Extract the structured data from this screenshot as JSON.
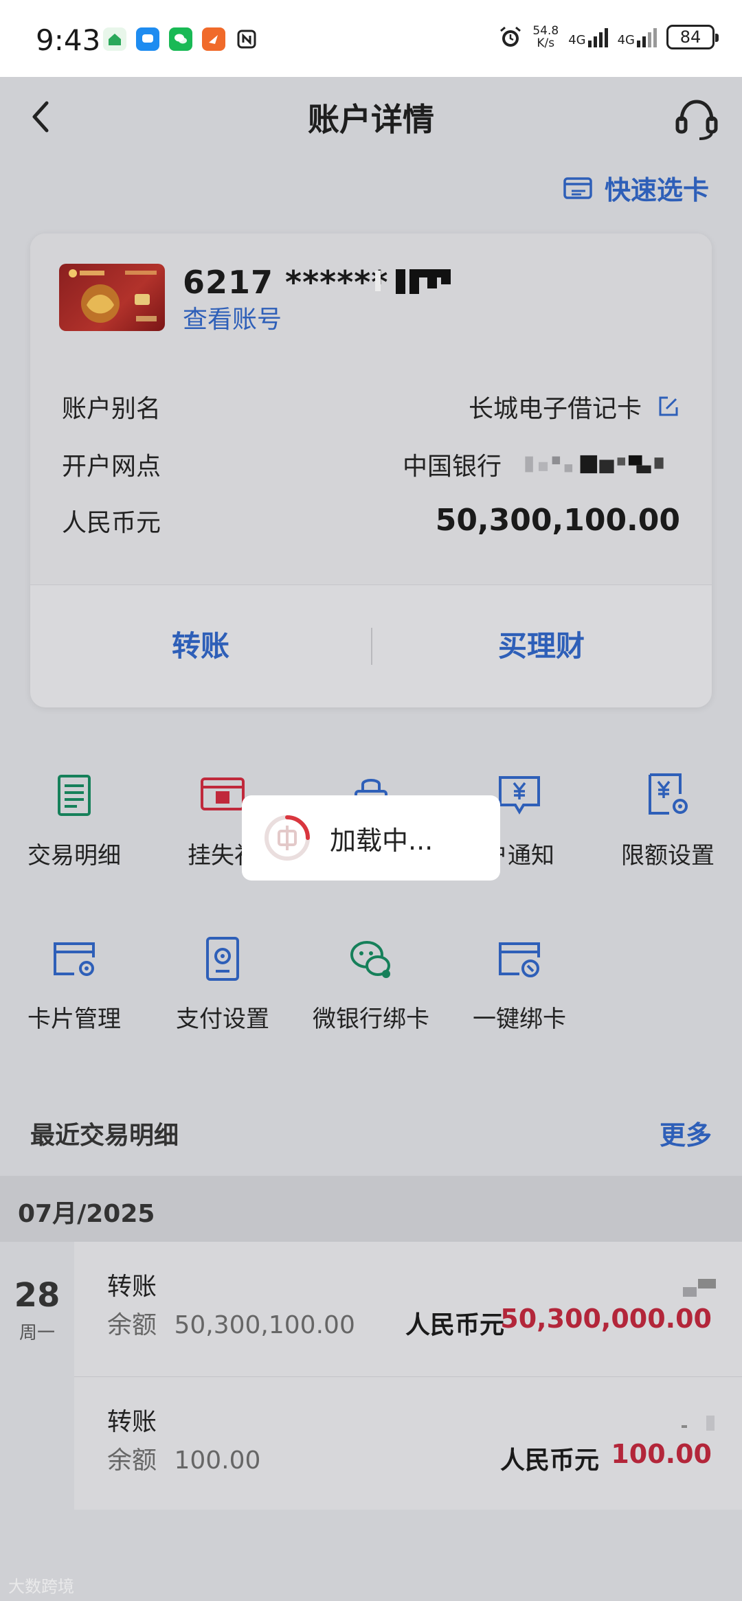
{
  "status_bar": {
    "time": "9:43",
    "net_speed_value": "54.8",
    "net_speed_unit": "K/s",
    "net1": "4G",
    "net2": "4G",
    "battery": "84"
  },
  "header": {
    "title": "账户详情",
    "quick_select": "快速选卡"
  },
  "card": {
    "number_prefix": "6217 ******",
    "view_account": "查看账号",
    "rows": [
      {
        "label": "账户别名",
        "value": "长城电子借记卡"
      },
      {
        "label": "开户网点",
        "value": "中国银行"
      },
      {
        "label": "人民币元",
        "value": "50,300,100.00"
      }
    ],
    "actions": {
      "transfer": "转账",
      "wealth": "买理财"
    }
  },
  "functions": [
    {
      "label": "交易明细",
      "icon": "transaction-detail-icon"
    },
    {
      "label": "挂失补",
      "icon": "report-loss-icon"
    },
    {
      "label": "",
      "icon": "lock-icon"
    },
    {
      "label": "户通知",
      "icon": "account-notice-icon"
    },
    {
      "label": "限额设置",
      "icon": "limit-setting-icon"
    },
    {
      "label": "卡片管理",
      "icon": "card-manage-icon"
    },
    {
      "label": "支付设置",
      "icon": "pay-setting-icon"
    },
    {
      "label": "微银行绑卡",
      "icon": "wechat-bind-icon"
    },
    {
      "label": "一键绑卡",
      "icon": "one-click-bind-icon"
    }
  ],
  "loading": {
    "text": "加载中..."
  },
  "recent": {
    "title": "最近交易明细",
    "more": "更多",
    "month": "07月/2025",
    "day": "28",
    "weekday": "周一",
    "transactions": [
      {
        "type": "转账",
        "balance_label": "余额",
        "balance": "50,300,100.00",
        "currency": "人民币元",
        "amount": "50,300,000.00"
      },
      {
        "type": "转账",
        "balance_label": "余额",
        "balance": "100.00",
        "currency": "人民币元",
        "amount": "100.00"
      }
    ]
  },
  "watermark": "大数跨境",
  "colors": {
    "accent": "#2e5fb8",
    "amount": "#b3263a",
    "icon_green": "#16805a",
    "icon_red": "#c0283b"
  }
}
